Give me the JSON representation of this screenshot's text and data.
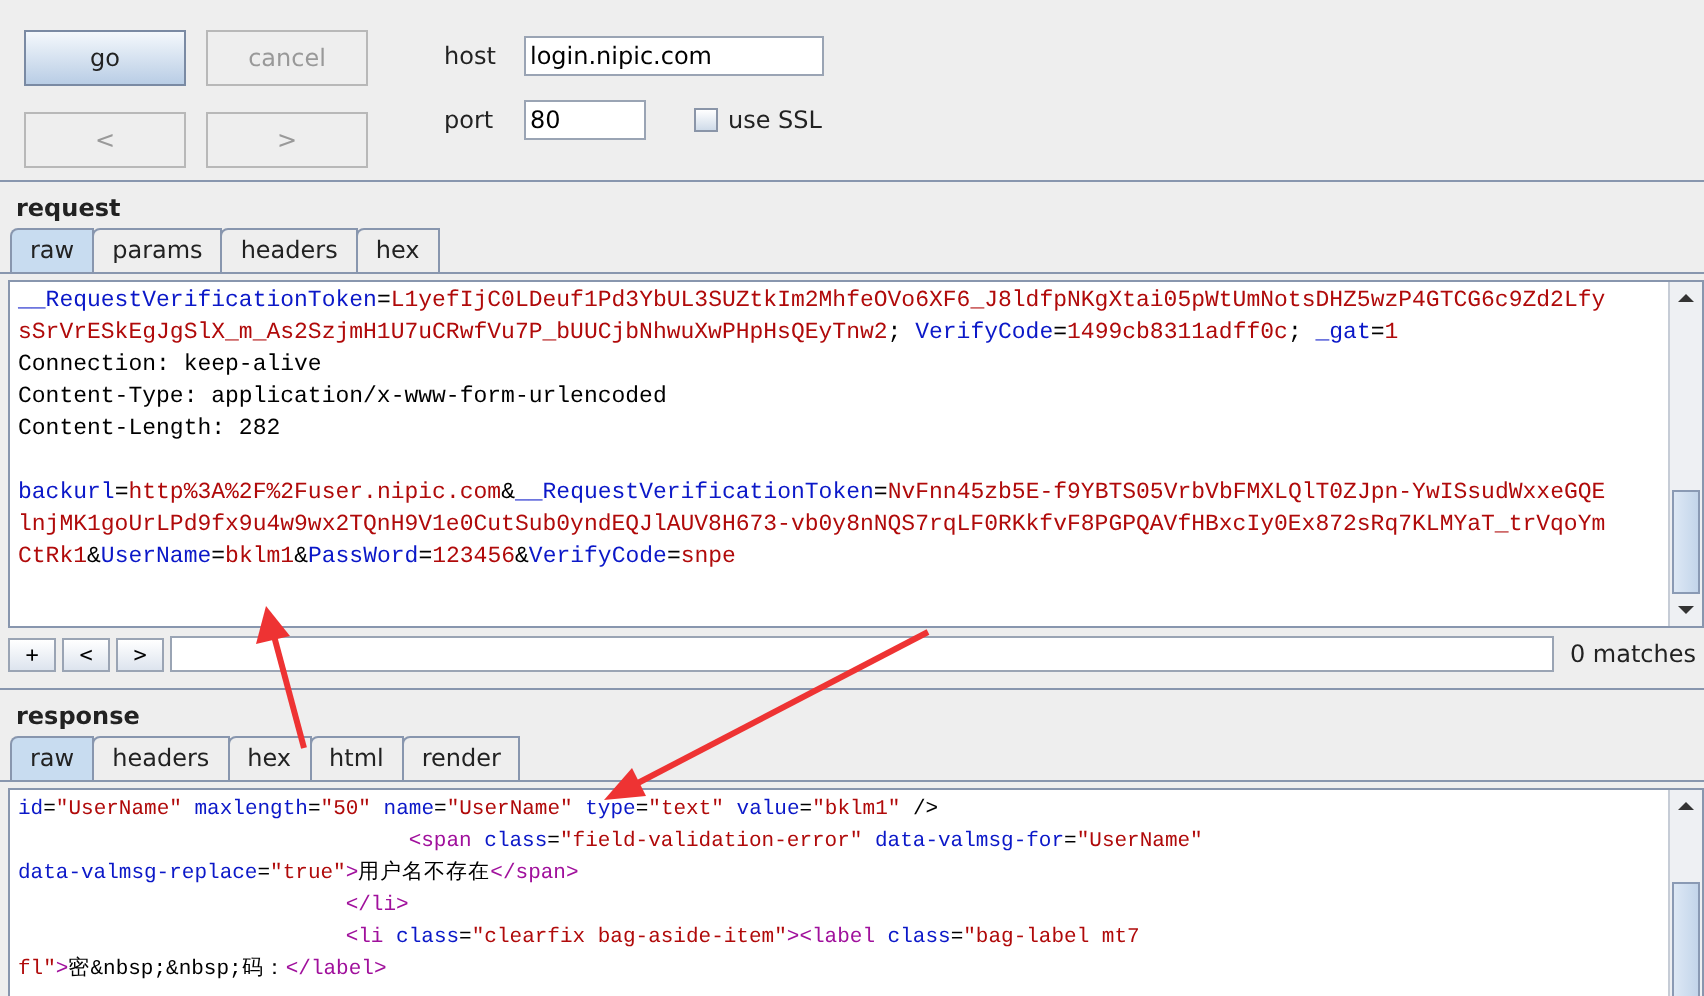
{
  "controls": {
    "buttons": [
      {
        "label": "go",
        "disabled": false,
        "primary": true
      },
      {
        "label": "cancel",
        "disabled": true,
        "primary": false
      },
      {
        "label": "<",
        "disabled": true,
        "primary": false
      },
      {
        "label": ">",
        "disabled": true,
        "primary": false
      }
    ],
    "host": {
      "label": "host",
      "value": "login.nipic.com"
    },
    "port": {
      "label": "port",
      "value": "80"
    },
    "ssl": {
      "label": "use SSL",
      "checked": false
    }
  },
  "request": {
    "title": "request",
    "tabs": [
      {
        "label": "raw",
        "selected": true
      },
      {
        "label": "params",
        "selected": false
      },
      {
        "label": "headers",
        "selected": false
      },
      {
        "label": "hex",
        "selected": false
      }
    ],
    "header_lines": [
      [
        {
          "kind": "key",
          "text": "__RequestVerificationToken"
        },
        {
          "kind": "plain",
          "text": "="
        },
        {
          "kind": "value",
          "text": "L1yefIjC0LDeuf1Pd3YbUL3SUZtkIm2MhfeOVo6XF6_J8ldfpNKgXtai05pWtUmNotsDHZ5wzP4GTCG6c9Zd2Lfy"
        }
      ],
      [
        {
          "kind": "value",
          "text": "sSrVrESkEgJgSlX_m_As2SzjmH1U7uCRwfVu7P_bUUCjbNhwuXwPHpHsQEyTnw2"
        },
        {
          "kind": "plain",
          "text": "; "
        },
        {
          "kind": "key",
          "text": "VerifyCode"
        },
        {
          "kind": "plain",
          "text": "="
        },
        {
          "kind": "value",
          "text": "1499cb8311adff0c"
        },
        {
          "kind": "plain",
          "text": "; "
        },
        {
          "kind": "key",
          "text": "_gat"
        },
        {
          "kind": "plain",
          "text": "="
        },
        {
          "kind": "value",
          "text": "1"
        }
      ],
      [
        {
          "kind": "plain",
          "text": "Connection: keep-alive"
        }
      ],
      [
        {
          "kind": "plain",
          "text": "Content-Type: application/x-www-form-urlencoded"
        }
      ],
      [
        {
          "kind": "plain",
          "text": "Content-Length: 282"
        }
      ]
    ],
    "body_lines": [
      [
        {
          "kind": "key",
          "text": "backurl"
        },
        {
          "kind": "plain",
          "text": "="
        },
        {
          "kind": "value",
          "text": "http%3A%2F%2Fuser.nipic.com"
        },
        {
          "kind": "plain",
          "text": "&"
        },
        {
          "kind": "key",
          "text": "__RequestVerificationToken"
        },
        {
          "kind": "plain",
          "text": "="
        },
        {
          "kind": "value",
          "text": "NvFnn45zb5E-f9YBTS05VrbVbFMXLQlT0ZJpn-YwISsudWxxeGQE"
        }
      ],
      [
        {
          "kind": "value",
          "text": "lnjMK1goUrLPd9fx9u4w9wx2TQnH9V1e0CutSub0yndEQJlAUV8H673-vb0y8nNQS7rqLF0RKkfvF8PGPQAVfHBxcIy0Ex872sRq7KLMYaT_trVqoYm"
        }
      ],
      [
        {
          "kind": "value",
          "text": "CtRk1"
        },
        {
          "kind": "plain",
          "text": "&"
        },
        {
          "kind": "key",
          "text": "UserName"
        },
        {
          "kind": "plain",
          "text": "="
        },
        {
          "kind": "value",
          "text": "bklm1"
        },
        {
          "kind": "plain",
          "text": "&"
        },
        {
          "kind": "key",
          "text": "PassWord"
        },
        {
          "kind": "plain",
          "text": "="
        },
        {
          "kind": "value",
          "text": "123456"
        },
        {
          "kind": "plain",
          "text": "&"
        },
        {
          "kind": "key",
          "text": "VerifyCode"
        },
        {
          "kind": "plain",
          "text": "="
        },
        {
          "kind": "value",
          "text": "snpe"
        }
      ]
    ],
    "search": {
      "buttons": [
        "+",
        "<",
        ">"
      ],
      "matches": "0 matches"
    }
  },
  "response": {
    "title": "response",
    "tabs": [
      {
        "label": "raw",
        "selected": true
      },
      {
        "label": "headers",
        "selected": false
      },
      {
        "label": "hex",
        "selected": false
      },
      {
        "label": "html",
        "selected": false
      },
      {
        "label": "render",
        "selected": false
      }
    ],
    "lines": [
      [
        {
          "kind": "key",
          "text": "id"
        },
        {
          "kind": "plain",
          "text": "="
        },
        {
          "kind": "value",
          "text": "\"UserName\""
        },
        {
          "kind": "key",
          "text": " maxlength"
        },
        {
          "kind": "plain",
          "text": "="
        },
        {
          "kind": "value",
          "text": "\"50\""
        },
        {
          "kind": "key",
          "text": " name"
        },
        {
          "kind": "plain",
          "text": "="
        },
        {
          "kind": "value",
          "text": "\"UserName\""
        },
        {
          "kind": "key",
          "text": " type"
        },
        {
          "kind": "plain",
          "text": "="
        },
        {
          "kind": "value",
          "text": "\"text\""
        },
        {
          "kind": "key",
          "text": " value"
        },
        {
          "kind": "plain",
          "text": "="
        },
        {
          "kind": "value",
          "text": "\"bklm1\""
        },
        {
          "kind": "plain",
          "text": " />"
        }
      ],
      [
        {
          "kind": "tag",
          "text": "                               <span"
        },
        {
          "kind": "key",
          "text": " class"
        },
        {
          "kind": "plain",
          "text": "="
        },
        {
          "kind": "value",
          "text": "\"field-validation-error\""
        },
        {
          "kind": "key",
          "text": " data-valmsg-for"
        },
        {
          "kind": "plain",
          "text": "="
        },
        {
          "kind": "value",
          "text": "\"UserName\""
        }
      ],
      [
        {
          "kind": "key",
          "text": "data-valmsg-replace"
        },
        {
          "kind": "plain",
          "text": "="
        },
        {
          "kind": "value",
          "text": "\"true\""
        },
        {
          "kind": "tag",
          "text": ">"
        },
        {
          "kind": "plain",
          "text": "用户名不存在"
        },
        {
          "kind": "tag",
          "text": "</span>"
        }
      ],
      [
        {
          "kind": "tag",
          "text": "                          </li>"
        }
      ],
      [
        {
          "kind": "tag",
          "text": "                          <li"
        },
        {
          "kind": "key",
          "text": " class"
        },
        {
          "kind": "plain",
          "text": "="
        },
        {
          "kind": "value",
          "text": "\"clearfix bag-aside-item\""
        },
        {
          "kind": "tag",
          "text": "><label"
        },
        {
          "kind": "key",
          "text": " class"
        },
        {
          "kind": "plain",
          "text": "="
        },
        {
          "kind": "value",
          "text": "\"bag-label mt7"
        }
      ],
      [
        {
          "kind": "value",
          "text": "fl\""
        },
        {
          "kind": "tag",
          "text": ">"
        },
        {
          "kind": "plain",
          "text": "密&nbsp;&nbsp;码："
        },
        {
          "kind": "tag",
          "text": "</label>"
        }
      ]
    ]
  }
}
